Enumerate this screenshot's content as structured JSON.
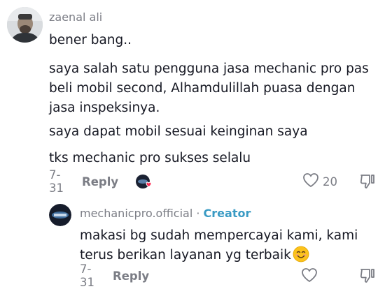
{
  "comment": {
    "username": "zaenal ali",
    "paragraphs": [
      "bener bang..",
      "saya salah satu pengguna jasa mechanic pro pas",
      "beli mobil second, Alhamdulillah puasa dengan",
      "jasa inspeksinya.",
      "saya dapat mobil sesuai keinginan saya",
      "tks mechanic pro sukses selalu"
    ],
    "date": "7-31",
    "reply_label": "Reply",
    "like_count": "20",
    "creator_liked": true
  },
  "reply": {
    "username": "mechanicpro.official",
    "separator": " · ",
    "creator_badge": "Creator",
    "lines": [
      "makasi bg sudah mempercayai kami, kami",
      "terus berikan layanan yg terbaik"
    ],
    "emoji": "smiling-face-icon",
    "date": "7-31",
    "reply_label": "Reply"
  },
  "colors": {
    "text": "#161823",
    "muted": "#7b7d85",
    "creator": "#3a9bc4",
    "heart": "#fe2c55"
  }
}
